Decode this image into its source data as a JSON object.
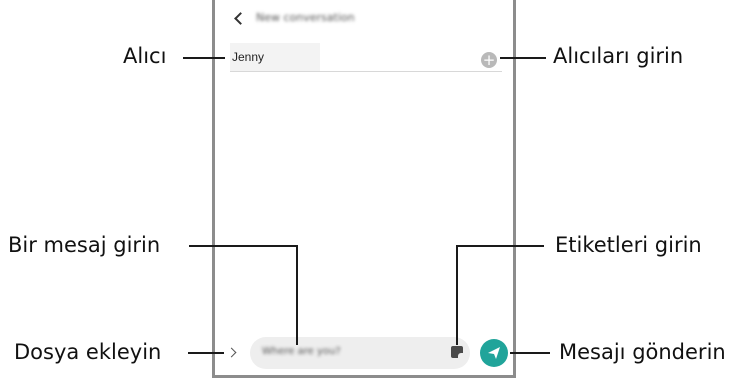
{
  "screen": {
    "header_title": "New conversation",
    "recipient_value": "Jenny",
    "message_placeholder": "Where are you?"
  },
  "callouts": {
    "recipient": "Alıcı",
    "enter_recipients": "Alıcıları girin",
    "enter_message": "Bir mesaj girin",
    "enter_stickers": "Etiketleri girin",
    "attach_file": "Dosya ekleyin",
    "send_message": "Mesajı gönderin"
  },
  "icons": {
    "back": "chevron-left-icon",
    "add_recipient": "plus-circle-icon",
    "attach": "chevron-right-icon",
    "sticker": "sticker-icon",
    "send": "send-icon"
  },
  "colors": {
    "accent": "#20a49a",
    "frame": "#8c8c8c"
  }
}
